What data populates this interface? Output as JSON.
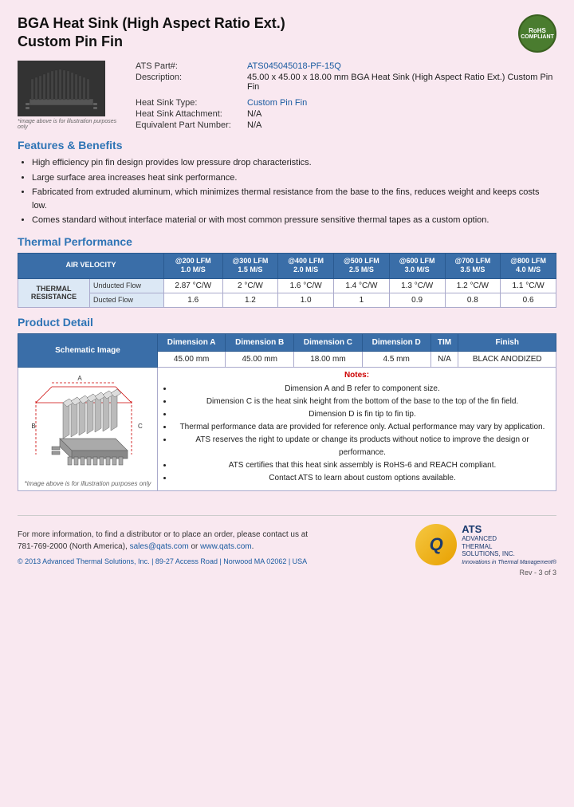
{
  "header": {
    "title_line1": "BGA Heat Sink (High Aspect Ratio Ext.)",
    "title_line2": "Custom Pin Fin",
    "rohs": "RoHS\nCOMPLIANT"
  },
  "product_info": {
    "part_label": "ATS Part#:",
    "part_number": "ATS045045018-PF-15Q",
    "description_label": "Description:",
    "description": "45.00 x 45.00 x 18.00 mm  BGA Heat Sink (High Aspect Ratio Ext.) Custom Pin Fin",
    "heat_sink_type_label": "Heat Sink Type:",
    "heat_sink_type": "Custom Pin Fin",
    "heat_sink_attachment_label": "Heat Sink Attachment:",
    "heat_sink_attachment": "N/A",
    "equivalent_part_label": "Equivalent Part Number:",
    "equivalent_part": "N/A",
    "image_caption": "*image above is for illustration purposes only"
  },
  "features": {
    "section_title": "Features & Benefits",
    "items": [
      "High efficiency pin fin design provides low pressure drop characteristics.",
      "Large surface area increases heat sink performance.",
      "Fabricated from extruded aluminum, which minimizes thermal resistance from the base to the fins, reduces weight and keeps costs low.",
      "Comes standard without interface material or with most common pressure sensitive thermal tapes as a custom option."
    ]
  },
  "thermal_performance": {
    "section_title": "Thermal Performance",
    "headers": {
      "air_velocity": "AIR VELOCITY",
      "col1": "@200 LFM\n1.0 M/S",
      "col2": "@300 LFM\n1.5 M/S",
      "col3": "@400 LFM\n2.0 M/S",
      "col4": "@500 LFM\n2.5 M/S",
      "col5": "@600 LFM\n3.0 M/S",
      "col6": "@700 LFM\n3.5 M/S",
      "col7": "@800 LFM\n4.0 M/S"
    },
    "row_label": "THERMAL RESISTANCE",
    "rows": [
      {
        "type": "Unducted Flow",
        "values": [
          "2.87 °C/W",
          "2 °C/W",
          "1.6 °C/W",
          "1.4 °C/W",
          "1.3 °C/W",
          "1.2 °C/W",
          "1.1 °C/W"
        ]
      },
      {
        "type": "Ducted Flow",
        "values": [
          "1.6",
          "1.2",
          "1.0",
          "1",
          "0.9",
          "0.8",
          "0.6"
        ]
      }
    ]
  },
  "product_detail": {
    "section_title": "Product Detail",
    "headers": [
      "Schematic Image",
      "Dimension A",
      "Dimension B",
      "Dimension C",
      "Dimension D",
      "TIM",
      "Finish"
    ],
    "dim_a": "45.00 mm",
    "dim_b": "45.00 mm",
    "dim_c": "18.00 mm",
    "dim_d": "4.5 mm",
    "tim": "N/A",
    "finish": "BLACK ANODIZED",
    "notes_title": "Notes:",
    "notes": [
      "Dimension A and B refer to component size.",
      "Dimension C is the heat sink height from the bottom of the base to the top of the fin field.",
      "Dimension D is fin tip to fin tip.",
      "Thermal performance data are provided for reference only. Actual performance may vary by application.",
      "ATS reserves the right to update or change its products without notice to improve the design or performance.",
      "ATS certifies that this heat sink assembly is RoHS-6 and REACH compliant.",
      "Contact ATS to learn about custom options available."
    ],
    "schematic_caption": "*image above is for illustration purposes only"
  },
  "footer": {
    "contact_text": "For more information, to find a distributor or to place an order, please contact us at\n781-769-2000 (North America),",
    "email": "sales@qats.com",
    "or": " or ",
    "website": "www.qats.com",
    "period": ".",
    "copyright": "© 2013 Advanced Thermal Solutions, Inc.  |  89-27 Access Road  |  Norwood MA  02062  |  USA",
    "company_name": "ATS",
    "company_full": "ADVANCED\nTHERMAL\nSOLUTIONS, INC.",
    "tagline": "Innovations in Thermal Management®",
    "page_number": "Rev - 3 of 3"
  }
}
